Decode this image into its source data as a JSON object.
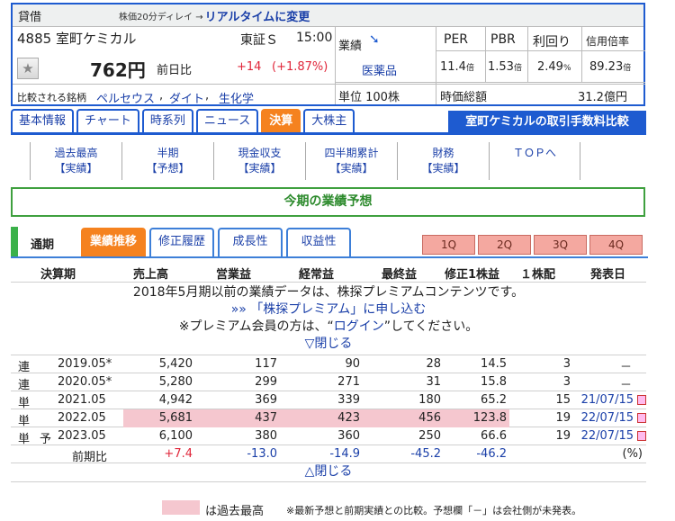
{
  "quote": {
    "header_label": "貸借",
    "delay_text": "株価20分ディレイ →",
    "realtime_link": "リアルタイムに変更",
    "code_name": "4885 室町ケミカル",
    "market": "東証Ｓ",
    "time": "15:00",
    "price": "762円",
    "prev_label": "前日比",
    "change": "+14",
    "change_pct": "(+1.87%)",
    "gyoseki_label": "業績",
    "industry": "医薬品",
    "unit": "単位 100株",
    "compare_label": "比較される銘柄",
    "compare_links": [
      "ペルセウス",
      "ダイト",
      "生化学"
    ],
    "metrics_headers": [
      "PER",
      "PBR",
      "利回り",
      "信用倍率"
    ],
    "per": "11.4",
    "per_unit": "倍",
    "pbr": "1.53",
    "pbr_unit": "倍",
    "yield": "2.49",
    "yield_unit": "%",
    "margin": "89.23",
    "margin_unit": "倍",
    "mcap_label": "時価総額",
    "mcap": "31.2億円"
  },
  "tabs": [
    "基本情報",
    "チャート",
    "時系列",
    "ニュース",
    "決算",
    "大株主"
  ],
  "active_tab": "決算",
  "compare_button": "室町ケミカルの取引手数料比較",
  "subnav": [
    {
      "l1": "過去最高",
      "l2": "【実績】"
    },
    {
      "l1": "半期",
      "l2": "【予想】"
    },
    {
      "l1": "現金収支",
      "l2": "【実績】"
    },
    {
      "l1": "四半期累計",
      "l2": "【実績】"
    },
    {
      "l1": "財務",
      "l2": "【実績】"
    },
    {
      "l1": "ＴＯＰへ",
      "l2": ""
    }
  ],
  "forecast_title": "今期の業績予想",
  "period_label": "通期",
  "period_tabs": [
    "業績推移",
    "修正履歴",
    "成長性",
    "収益性"
  ],
  "quarter_tabs": [
    "1Q",
    "2Q",
    "3Q",
    "4Q"
  ],
  "table": {
    "headers": [
      "決算期",
      "売上高",
      "営業益",
      "経常益",
      "最終益",
      "修正1株益",
      "１株配",
      "発表日"
    ],
    "premium_note": "2018年5月期以前の業績データは、株探プレミアムコンテンツです。",
    "premium_link": "»» 「株探プレミアム」に申し込む",
    "login_pre": "※プレミアム会員の方は、“",
    "login_link": "ログイン",
    "login_post": "”してください。",
    "close_top": "▽閉じる",
    "rows": [
      {
        "type": "連",
        "fc": "",
        "period": "2019.05*",
        "sales": "5,420",
        "op": "117",
        "ord": "90",
        "net": "28",
        "eps": "14.5",
        "div": "3",
        "date": "－"
      },
      {
        "type": "連",
        "fc": "",
        "period": "2020.05*",
        "sales": "5,280",
        "op": "299",
        "ord": "271",
        "net": "31",
        "eps": "15.8",
        "div": "3",
        "date": "－"
      },
      {
        "type": "単",
        "fc": "",
        "period": "2021.05",
        "sales": "4,942",
        "op": "369",
        "ord": "339",
        "net": "180",
        "eps": "65.2",
        "div": "15",
        "date": "21/07/15"
      },
      {
        "type": "単",
        "fc": "",
        "period": "2022.05",
        "sales": "5,681",
        "op": "437",
        "ord": "423",
        "net": "456",
        "eps": "123.8",
        "div": "19",
        "date": "22/07/15"
      },
      {
        "type": "単",
        "fc": "予",
        "period": "2023.05",
        "sales": "6,100",
        "op": "380",
        "ord": "360",
        "net": "250",
        "eps": "66.6",
        "div": "19",
        "date": "22/07/15"
      }
    ],
    "change_row": {
      "label": "前期比",
      "sales": "+7.4",
      "op": "-13.0",
      "ord": "-14.9",
      "net": "-45.2",
      "eps": "-46.2",
      "date": "(%)"
    },
    "close_bottom": "△閉じる"
  },
  "legend_text": "は過去最高",
  "footnote": "※最新予想と前期実績との比較。予想欄「－」は会社側が未発表。",
  "colors": {
    "accent": "#1e5bd0",
    "active_tab": "#f5821f",
    "green": "#3bb14a",
    "highlight": "#f5c7cf",
    "up": "#e0263a",
    "down": "#1a3fa8"
  }
}
